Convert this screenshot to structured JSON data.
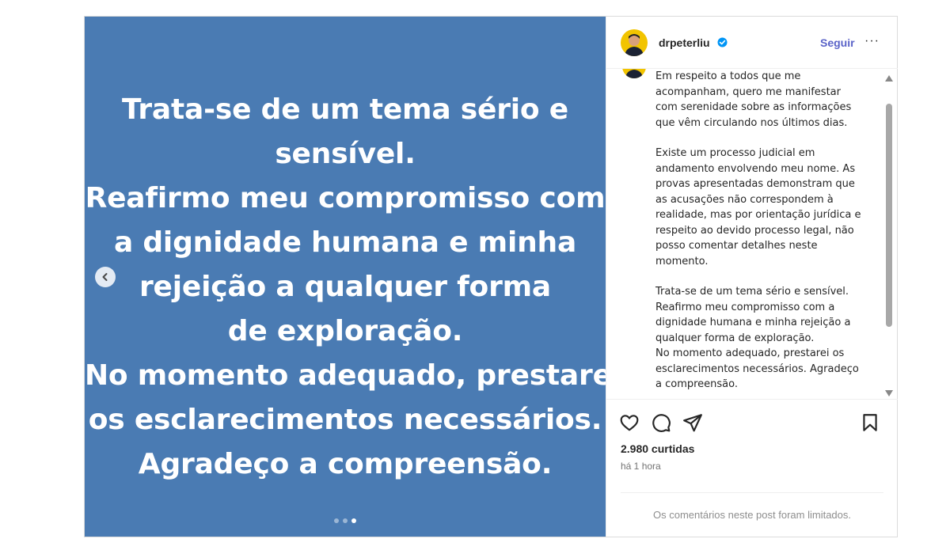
{
  "slide": {
    "lines": [
      "Trata-se de um tema sério e",
      "sensível.",
      "Reafirmo meu compromisso com",
      "a dignidade humana e minha",
      "rejeição a qualquer forma",
      "de exploração.",
      "No momento adequado, prestarei",
      "os esclarecimentos necessários.",
      "Agradeço a compreensão."
    ],
    "background_color": "#4a7bb3",
    "dots_total": 3,
    "dots_active_index": 2
  },
  "header": {
    "username": "drpeterliu",
    "verified_icon": "verified-badge-icon",
    "follow_label": "Seguir",
    "more_label": "···"
  },
  "caption": {
    "paragraphs": [
      [
        "Em respeito a todos que me",
        "acompanham, quero me manifestar",
        "com serenidade sobre as informações",
        "que vêm circulando nos últimos dias."
      ],
      [
        "Existe um processo judicial em",
        "andamento envolvendo meu nome. As",
        "provas apresentadas demonstram que",
        "as acusações não correspondem à",
        "realidade, mas por orientação jurídica e",
        "respeito ao devido processo legal, não",
        "posso comentar detalhes neste",
        "momento."
      ],
      [
        "Trata-se de um tema sério e sensível.",
        "Reafirmo meu compromisso com a",
        "dignidade humana e minha rejeição a",
        "qualquer forma de exploração.",
        "No momento adequado, prestarei os",
        "esclarecimentos necessários. Agradeço",
        "a compreensão."
      ]
    ]
  },
  "actions": {
    "icons": [
      "heart-icon",
      "comment-icon",
      "share-icon",
      "bookmark-icon"
    ],
    "likes_text": "2.980 curtidas",
    "time_text": "há 1 hora",
    "comments_limited_text": "Os comentários neste post foram limitados."
  },
  "colors": {
    "follow": "#5a63c8",
    "verified": "#0095f6",
    "text": "#262626",
    "muted": "#737373"
  }
}
